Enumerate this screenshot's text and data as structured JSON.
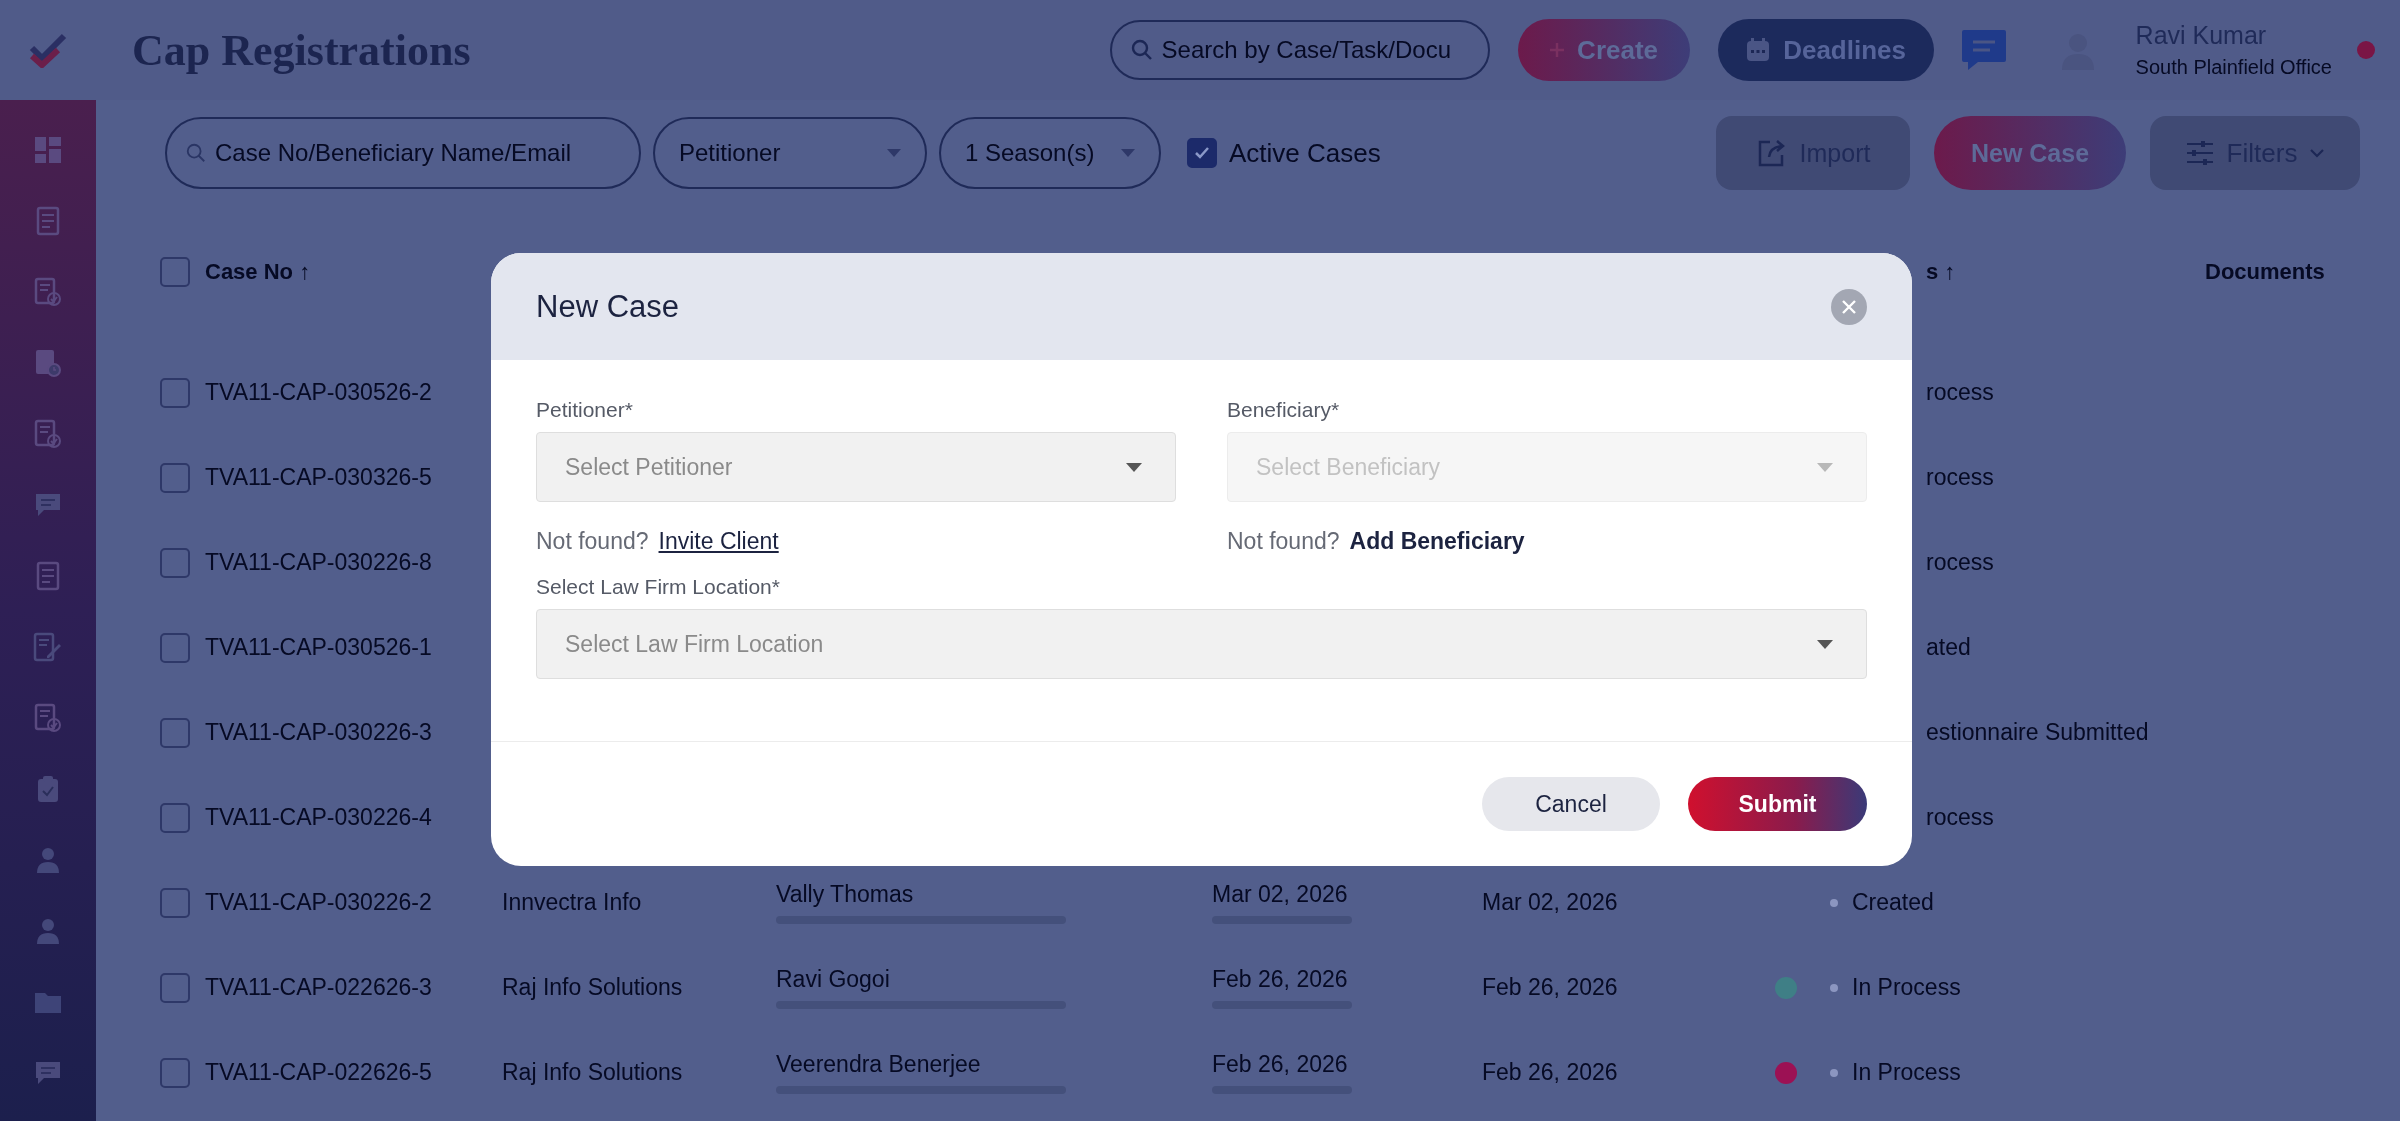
{
  "app": {
    "title": "Cap Registrations"
  },
  "header": {
    "search": {
      "placeholder": "Search by Case/Task/Docu"
    },
    "create_button": "Create",
    "deadlines_button": "Deadlines",
    "user": {
      "name": "Ravi Kumar",
      "office": "South Plainfield Office"
    }
  },
  "sidebar": {
    "items": [
      {
        "kind": "dashboard"
      },
      {
        "kind": "document"
      },
      {
        "kind": "doc-check"
      },
      {
        "kind": "doc-clock"
      },
      {
        "kind": "doc-check"
      },
      {
        "kind": "chat"
      },
      {
        "kind": "document"
      },
      {
        "kind": "edit"
      },
      {
        "kind": "doc-check"
      },
      {
        "kind": "clipboard"
      },
      {
        "kind": "person"
      },
      {
        "kind": "person"
      },
      {
        "kind": "folder"
      },
      {
        "kind": "chat"
      }
    ]
  },
  "filters": {
    "search": {
      "placeholder": "Case No/Beneficiary Name/Email"
    },
    "petitioner": {
      "placeholder": "Petitioner"
    },
    "season": {
      "value": "1 Season(s)"
    },
    "active_cases": {
      "label": "Active Cases",
      "checked": true
    },
    "import_button": "Import",
    "new_case_button": "New Case",
    "filters_button": "Filters"
  },
  "table": {
    "columns": [
      {
        "label": "Case No ↑"
      },
      {
        "label": "s ↑"
      },
      {
        "label": "Documents"
      }
    ],
    "header_checked": false,
    "rows_behind_modal": [
      {
        "case_no": "TVA11-CAP-030526-2",
        "status": "rocess",
        "checked": false
      },
      {
        "case_no": "TVA11-CAP-030326-5",
        "status": "rocess",
        "checked": false
      },
      {
        "case_no": "TVA11-CAP-030226-8",
        "status": "rocess",
        "checked": false
      },
      {
        "case_no": "TVA11-CAP-030526-1",
        "status": "ated",
        "checked": false
      },
      {
        "case_no": "TVA11-CAP-030226-3",
        "status": "estionnaire Submitted",
        "checked": false
      },
      {
        "case_no": "TVA11-CAP-030226-4",
        "status": "rocess",
        "checked": false
      }
    ],
    "rows": [
      {
        "case_no": "TVA11-CAP-030226-2",
        "petitioner": "Innvectra Info",
        "beneficiary": "Vally Thomas",
        "created": "Mar 02, 2026",
        "date": "Mar 02, 2026",
        "status": "Created",
        "checked": false
      },
      {
        "case_no": "TVA11-CAP-022626-3",
        "petitioner": "Raj Info Solutions",
        "beneficiary": "Ravi Gogoi",
        "created": "Feb 26, 2026",
        "date": "Feb 26, 2026",
        "color": "#3f7f86",
        "status": "In Process",
        "checked": false
      },
      {
        "case_no": "TVA11-CAP-022626-5",
        "petitioner": "Raj Info Solutions",
        "beneficiary": "Veerendra Benerjee",
        "created": "Feb 26, 2026",
        "date": "Feb 26, 2026",
        "color": "#9c1154",
        "status": "In Process",
        "checked": false
      }
    ]
  },
  "modal": {
    "title": "New Case",
    "fields": [
      {
        "label": "Petitioner*",
        "placeholder": "Select Petitioner",
        "disabled": false,
        "note": "Not found?",
        "link": "Invite Client",
        "link_underlined": true
      },
      {
        "label": "Beneficiary*",
        "placeholder": "Select Beneficiary",
        "disabled": true,
        "note": "Not found?",
        "link": "Add Beneficiary",
        "link_underlined": false
      }
    ],
    "location": {
      "label": "Select Law Firm Location*",
      "placeholder": "Select Law Firm Location"
    },
    "cancel_button": "Cancel",
    "submit_button": "Submit"
  }
}
